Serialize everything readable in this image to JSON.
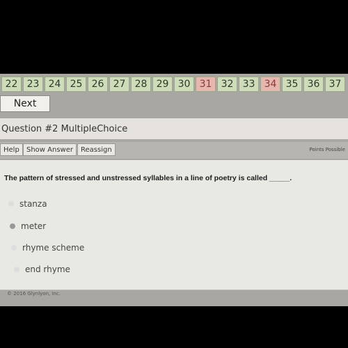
{
  "tiles": [
    {
      "label": "22",
      "status": "green"
    },
    {
      "label": "23",
      "status": "green"
    },
    {
      "label": "24",
      "status": "green"
    },
    {
      "label": "25",
      "status": "green"
    },
    {
      "label": "26",
      "status": "green"
    },
    {
      "label": "27",
      "status": "green"
    },
    {
      "label": "28",
      "status": "green"
    },
    {
      "label": "29",
      "status": "green"
    },
    {
      "label": "30",
      "status": "green"
    },
    {
      "label": "31",
      "status": "red"
    },
    {
      "label": "32",
      "status": "green"
    },
    {
      "label": "33",
      "status": "green"
    },
    {
      "label": "34",
      "status": "red"
    },
    {
      "label": "35",
      "status": "green"
    },
    {
      "label": "36",
      "status": "green"
    },
    {
      "label": "37",
      "status": "green"
    }
  ],
  "colors": {
    "green": "#cfdcb9",
    "red": "#e6b7ae"
  },
  "next_label": "Next",
  "question_header": "Question #2  MultipleChoice",
  "toolbar": {
    "help": "Help",
    "show_answer": "Show Answer",
    "reassign": "Reassign",
    "points": "Points Possible"
  },
  "question": "The pattern of stressed and unstressed syllables in a line of poetry is called _____.",
  "options": [
    {
      "label": "stanza",
      "selected": false
    },
    {
      "label": "meter",
      "selected": true
    },
    {
      "label": "rhyme scheme",
      "selected": false
    },
    {
      "label": "end rhyme",
      "selected": false
    }
  ],
  "footer": "© 2016 Glynlyon, Inc."
}
